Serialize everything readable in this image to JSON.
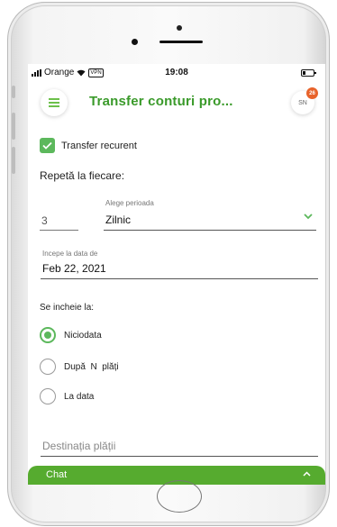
{
  "status_bar": {
    "carrier": "Orange",
    "wifi_icon": "wifi-icon",
    "vpn": "VPN",
    "time": "19:08"
  },
  "header": {
    "title": "Transfer conturi pro...",
    "avatar_initials": "SN",
    "notification_count": "26"
  },
  "form": {
    "recurring_checkbox": {
      "label": "Transfer recurent",
      "checked": true
    },
    "repeat_label": "Repetă la fiecare:",
    "interval_value": "3",
    "period_label": "Alege perioada",
    "period_value": "Zilnic",
    "start_date_label": "Incepe la data de",
    "start_date_value": "Feb 22, 2021",
    "ends_label": "Se incheie la:",
    "end_options": [
      {
        "label": "Niciodata",
        "selected": true
      },
      {
        "label": "După  N  plăți",
        "selected": false
      },
      {
        "label": "La data",
        "selected": false
      }
    ],
    "destination_placeholder": "Destinația plății"
  },
  "chat_bar": {
    "label": "Chat"
  },
  "colors": {
    "accent_green": "#5cb85c",
    "title_green": "#3a9a2a",
    "chat_green": "#56ab2f",
    "badge_orange": "#e8632b"
  }
}
